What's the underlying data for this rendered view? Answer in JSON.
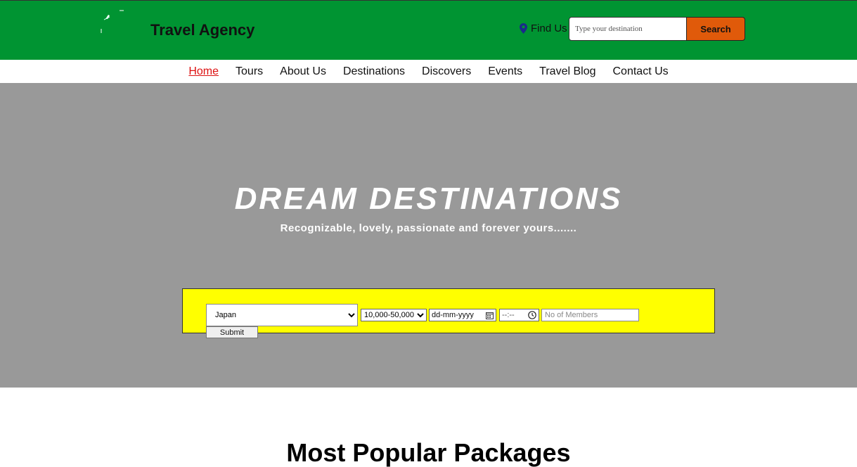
{
  "header": {
    "brand": "Travel Agency",
    "find_us": "Find Us",
    "search_placeholder": "Type your destination",
    "search_label": "Search"
  },
  "nav": {
    "items": [
      {
        "label": "Home",
        "active": true
      },
      {
        "label": "Tours"
      },
      {
        "label": "About Us"
      },
      {
        "label": "Destinations"
      },
      {
        "label": "Discovers"
      },
      {
        "label": "Events"
      },
      {
        "label": "Travel Blog"
      },
      {
        "label": "Contact Us"
      }
    ]
  },
  "hero": {
    "title": "DREAM DESTINATIONS",
    "subtitle": "Recognizable, lovely, passionate and forever yours.......",
    "background": "#999999"
  },
  "booking": {
    "destination": "Japan",
    "budget": "10,000-50,000",
    "date_placeholder": "dd-mm-yyyy",
    "time_placeholder": "--:--",
    "members_placeholder": "No of Members",
    "submit_label": "Submit",
    "background": "#ffff00"
  },
  "section": {
    "title": "Most Popular Packages"
  },
  "colors": {
    "header_bg": "#009432",
    "search_button": "#e05a0a",
    "nav_active": "#dd1111"
  }
}
